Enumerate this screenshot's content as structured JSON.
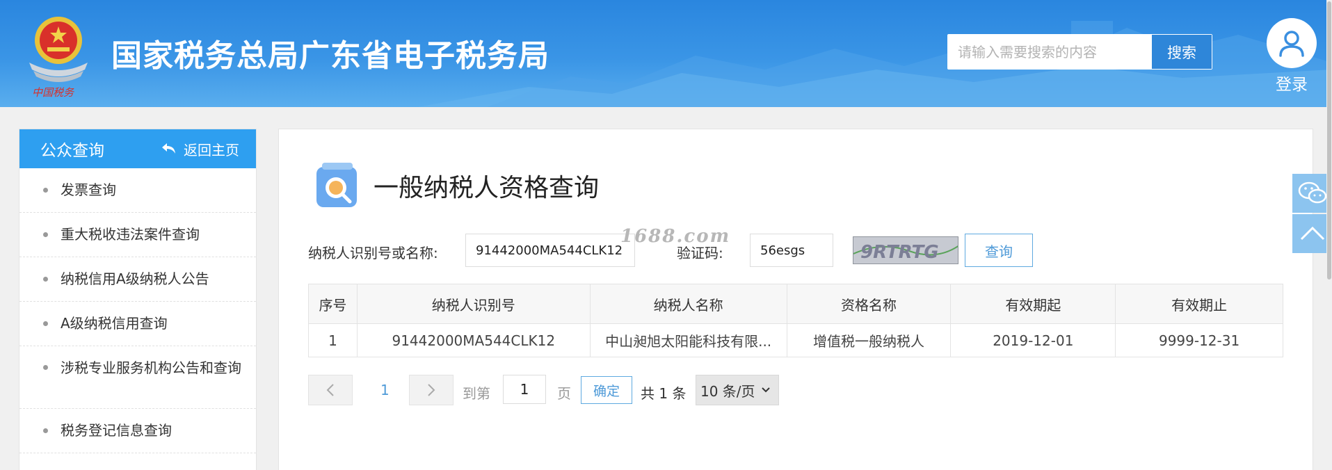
{
  "header": {
    "site_title": "国家税务总局广东省电子税务局",
    "search_placeholder": "请输入需要搜索的内容",
    "search_button": "搜索",
    "login_label": "登录"
  },
  "sidebar": {
    "title": "公众查询",
    "back_home": "返回主页",
    "items": [
      {
        "label": "发票查询"
      },
      {
        "label": "重大税收违法案件查询"
      },
      {
        "label": "纳税信用A级纳税人公告"
      },
      {
        "label": "A级纳税信用查询"
      },
      {
        "label": "涉税专业服务机构公告和查询"
      },
      {
        "label": "税务登记信息查询"
      }
    ]
  },
  "main": {
    "page_title": "一般纳税人资格查询",
    "form": {
      "taxpayer_label": "纳税人识别号或名称:",
      "taxpayer_value": "91442000MA544CLK12",
      "captcha_label": "验证码:",
      "captcha_value": "56esgs",
      "captcha_image_text": "9RTRTG",
      "query_button": "查询"
    },
    "table": {
      "headers": [
        "序号",
        "纳税人识别号",
        "纳税人名称",
        "资格名称",
        "有效期起",
        "有效期止"
      ],
      "rows": [
        [
          "1",
          "91442000MA544CLK12",
          "中山昶旭太阳能科技有限...",
          "增值税一般纳税人",
          "2019-12-01",
          "9999-12-31"
        ]
      ]
    },
    "pager": {
      "prev": "<",
      "current_page": "1",
      "next": ">",
      "goto_label": "到第",
      "goto_value": "1",
      "page_unit": "页",
      "confirm": "确定",
      "total": "共 1 条",
      "page_size": "10 条/页"
    },
    "watermark": "1688.com"
  },
  "colors": {
    "header_blue": "#2a86df",
    "sidebar_head": "#2e9ff0",
    "link_blue": "#4e9ad8"
  }
}
